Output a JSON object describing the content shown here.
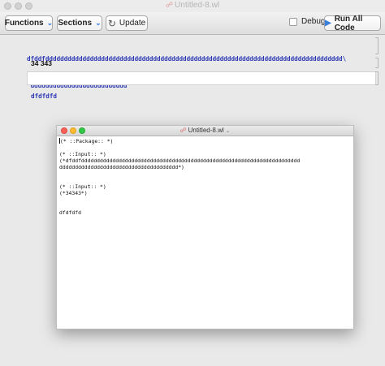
{
  "back_window": {
    "title": "Untitled-8.wl",
    "toolbar": {
      "functions_label": "Functions",
      "sections_label": "Sections",
      "update_label": "Update",
      "debug_label": "Debug",
      "debug_checked": false,
      "run_all_label": "Run All Code"
    },
    "cells": [
      {
        "code_lines": [
          "dfddfdddddddddddddddddddddddddddddddddddddddddddddddddddddddddddddddddddddddddddddddd\\",
          " dddddddddddddddddddddddddd"
        ]
      },
      {
        "output": "34 343"
      },
      {
        "code_lines": [
          "dfdfdfd"
        ]
      }
    ]
  },
  "front_window": {
    "title": "Untitled-8.wl",
    "lines": [
      "(* ::Package:: *)",
      "",
      "(* ::Input:: *)",
      "(*dfddfdddddddddddddddddddddddddddddddddddddddddddddddddddddddddddddddddddddd",
      "dddddddddddddddddddddddddddddddddddddd*)",
      "",
      "",
      "(* ::Input:: *)",
      "(*34343*)",
      "",
      "",
      "dfdfdfd"
    ]
  },
  "colors": {
    "code_blue": "#2c38b4",
    "run_icon_blue": "#3b7fdc",
    "close": "#fc5f57",
    "minimize": "#fdbc2e",
    "zoom": "#33c748"
  }
}
